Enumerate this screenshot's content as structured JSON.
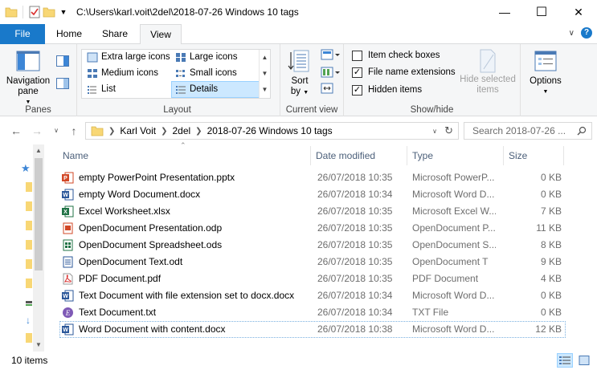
{
  "window": {
    "title": "C:\\Users\\karl.voit\\2del\\2018-07-26 Windows 10 tags",
    "minimize": "—",
    "maximize": "☐",
    "close": "✕"
  },
  "ribbon_tabs": [
    {
      "label": "File"
    },
    {
      "label": "Home"
    },
    {
      "label": "Share"
    },
    {
      "label": "View"
    }
  ],
  "ribbon": {
    "panes": {
      "label": "Panes",
      "navigation_pane_line1": "Navigation",
      "navigation_pane_line2": "pane"
    },
    "layout": {
      "label": "Layout",
      "items": [
        {
          "label": "Extra large icons"
        },
        {
          "label": "Large icons"
        },
        {
          "label": "Medium icons"
        },
        {
          "label": "Small icons"
        },
        {
          "label": "List"
        },
        {
          "label": "Details"
        }
      ],
      "selected": "Details"
    },
    "current_view": {
      "label": "Current view",
      "sort_by_line1": "Sort",
      "sort_by_line2": "by"
    },
    "show_hide": {
      "label": "Show/hide",
      "item_check_boxes": {
        "label": "Item check boxes",
        "checked": false
      },
      "file_name_extensions": {
        "label": "File name extensions",
        "checked": true
      },
      "hidden_items": {
        "label": "Hidden items",
        "checked": true
      },
      "hide_selected_line1": "Hide selected",
      "hide_selected_line2": "items"
    },
    "options": {
      "label": "Options"
    }
  },
  "address": {
    "crumbs": [
      "Karl Voit",
      "2del",
      "2018-07-26 Windows 10 tags"
    ],
    "search_placeholder": "Search 2018-07-26 ..."
  },
  "columns": {
    "name": "Name",
    "date": "Date modified",
    "type": "Type",
    "size": "Size"
  },
  "files": [
    {
      "name": "empty PowerPoint Presentation.pptx",
      "date": "26/07/2018 10:35",
      "type": "Microsoft PowerP...",
      "size": "0 KB",
      "icon": "powerpoint-icon",
      "color": "#d24726"
    },
    {
      "name": "empty Word Document.docx",
      "date": "26/07/2018 10:34",
      "type": "Microsoft Word D...",
      "size": "0 KB",
      "icon": "word-icon",
      "color": "#2b579a"
    },
    {
      "name": "Excel Worksheet.xlsx",
      "date": "26/07/2018 10:35",
      "type": "Microsoft Excel W...",
      "size": "7 KB",
      "icon": "excel-icon",
      "color": "#217346"
    },
    {
      "name": "OpenDocument Presentation.odp",
      "date": "26/07/2018 10:35",
      "type": "OpenDocument P...",
      "size": "11 KB",
      "icon": "odp-icon",
      "color": "#d24726"
    },
    {
      "name": "OpenDocument Spreadsheet.ods",
      "date": "26/07/2018 10:35",
      "type": "OpenDocument S...",
      "size": "8 KB",
      "icon": "ods-icon",
      "color": "#217346"
    },
    {
      "name": "OpenDocument Text.odt",
      "date": "26/07/2018 10:35",
      "type": "OpenDocument T",
      "size": "9 KB",
      "icon": "odt-icon",
      "color": "#2b579a"
    },
    {
      "name": "PDF Document.pdf",
      "date": "26/07/2018 10:35",
      "type": "PDF Document",
      "size": "4 KB",
      "icon": "pdf-icon",
      "color": "#d9302f"
    },
    {
      "name": "Text Document with file extension set to docx.docx",
      "date": "26/07/2018 10:34",
      "type": "Microsoft Word D...",
      "size": "0 KB",
      "icon": "word-icon",
      "color": "#2b579a"
    },
    {
      "name": "Text Document.txt",
      "date": "26/07/2018 10:34",
      "type": "TXT File",
      "size": "0 KB",
      "icon": "emacs-icon",
      "color": "#7f5ab6"
    },
    {
      "name": "Word Document with content.docx",
      "date": "26/07/2018 10:38",
      "type": "Microsoft Word D...",
      "size": "12 KB",
      "icon": "word-icon",
      "color": "#2b579a"
    }
  ],
  "status": {
    "item_count": "10 items"
  }
}
